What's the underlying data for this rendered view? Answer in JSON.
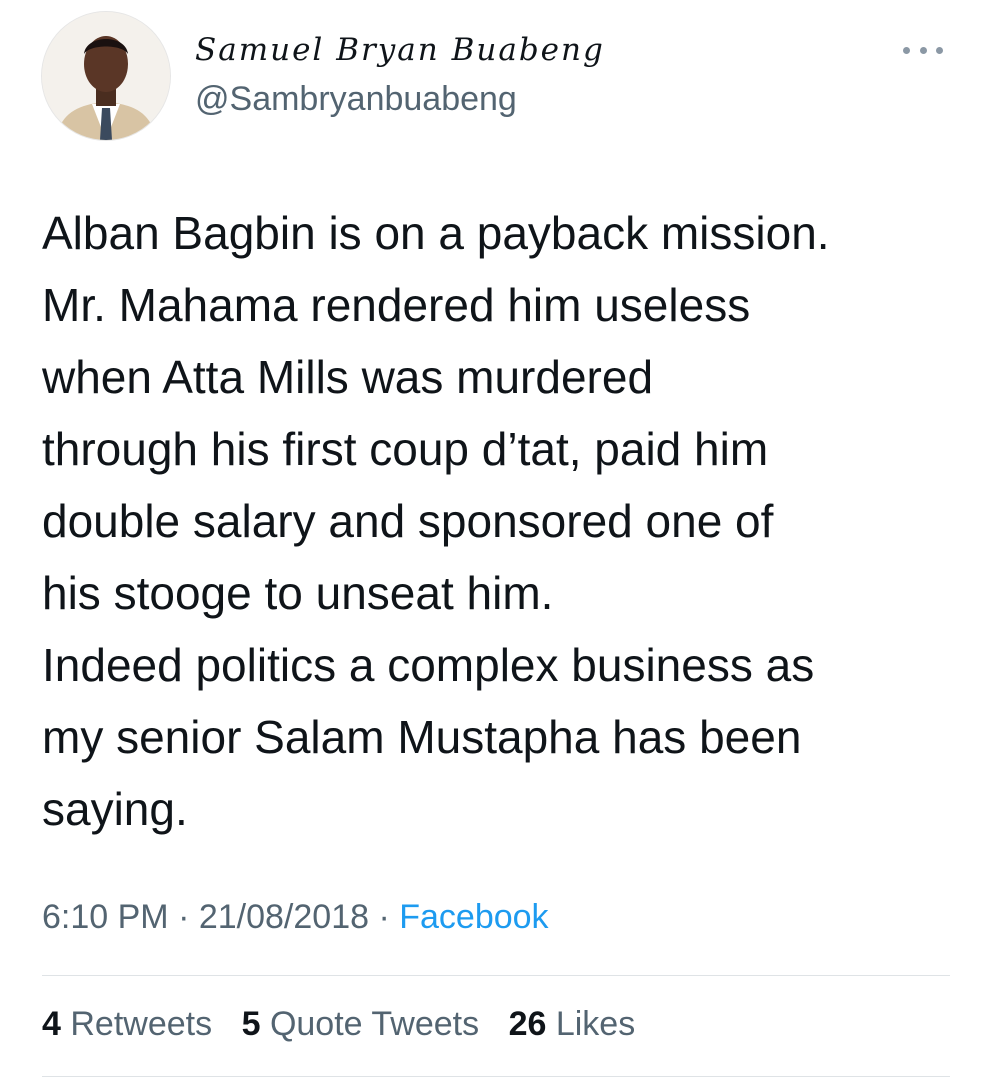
{
  "author": {
    "display_name": "Samuel Bryan Buabeng",
    "handle": "@Sambryanbuabeng",
    "avatar_icon": "profile-photo"
  },
  "more_icon": "more-horizontal-icon",
  "tweet": {
    "lines": [
      "Alban Bagbin is on a payback mission.",
      "Mr. Mahama rendered him useless",
      "when Atta Mills was murdered",
      "through his first coup d’tat, paid him",
      "double salary and sponsored one of",
      "his stooge to unseat him.",
      "Indeed politics a complex business as",
      "my senior Salam Mustapha has been",
      "saying."
    ]
  },
  "meta": {
    "time": "6:10 PM",
    "separator": " · ",
    "date": "21/08/2018",
    "source": "Facebook"
  },
  "stats": {
    "retweets_count": "4",
    "retweets_label": "Retweets",
    "quotes_count": "5",
    "quotes_label": "Quote Tweets",
    "likes_count": "26",
    "likes_label": "Likes"
  },
  "colors": {
    "text": "#0f1419",
    "secondary": "#536471",
    "link": "#1d9bf0",
    "divider": "#dfe3e6"
  }
}
